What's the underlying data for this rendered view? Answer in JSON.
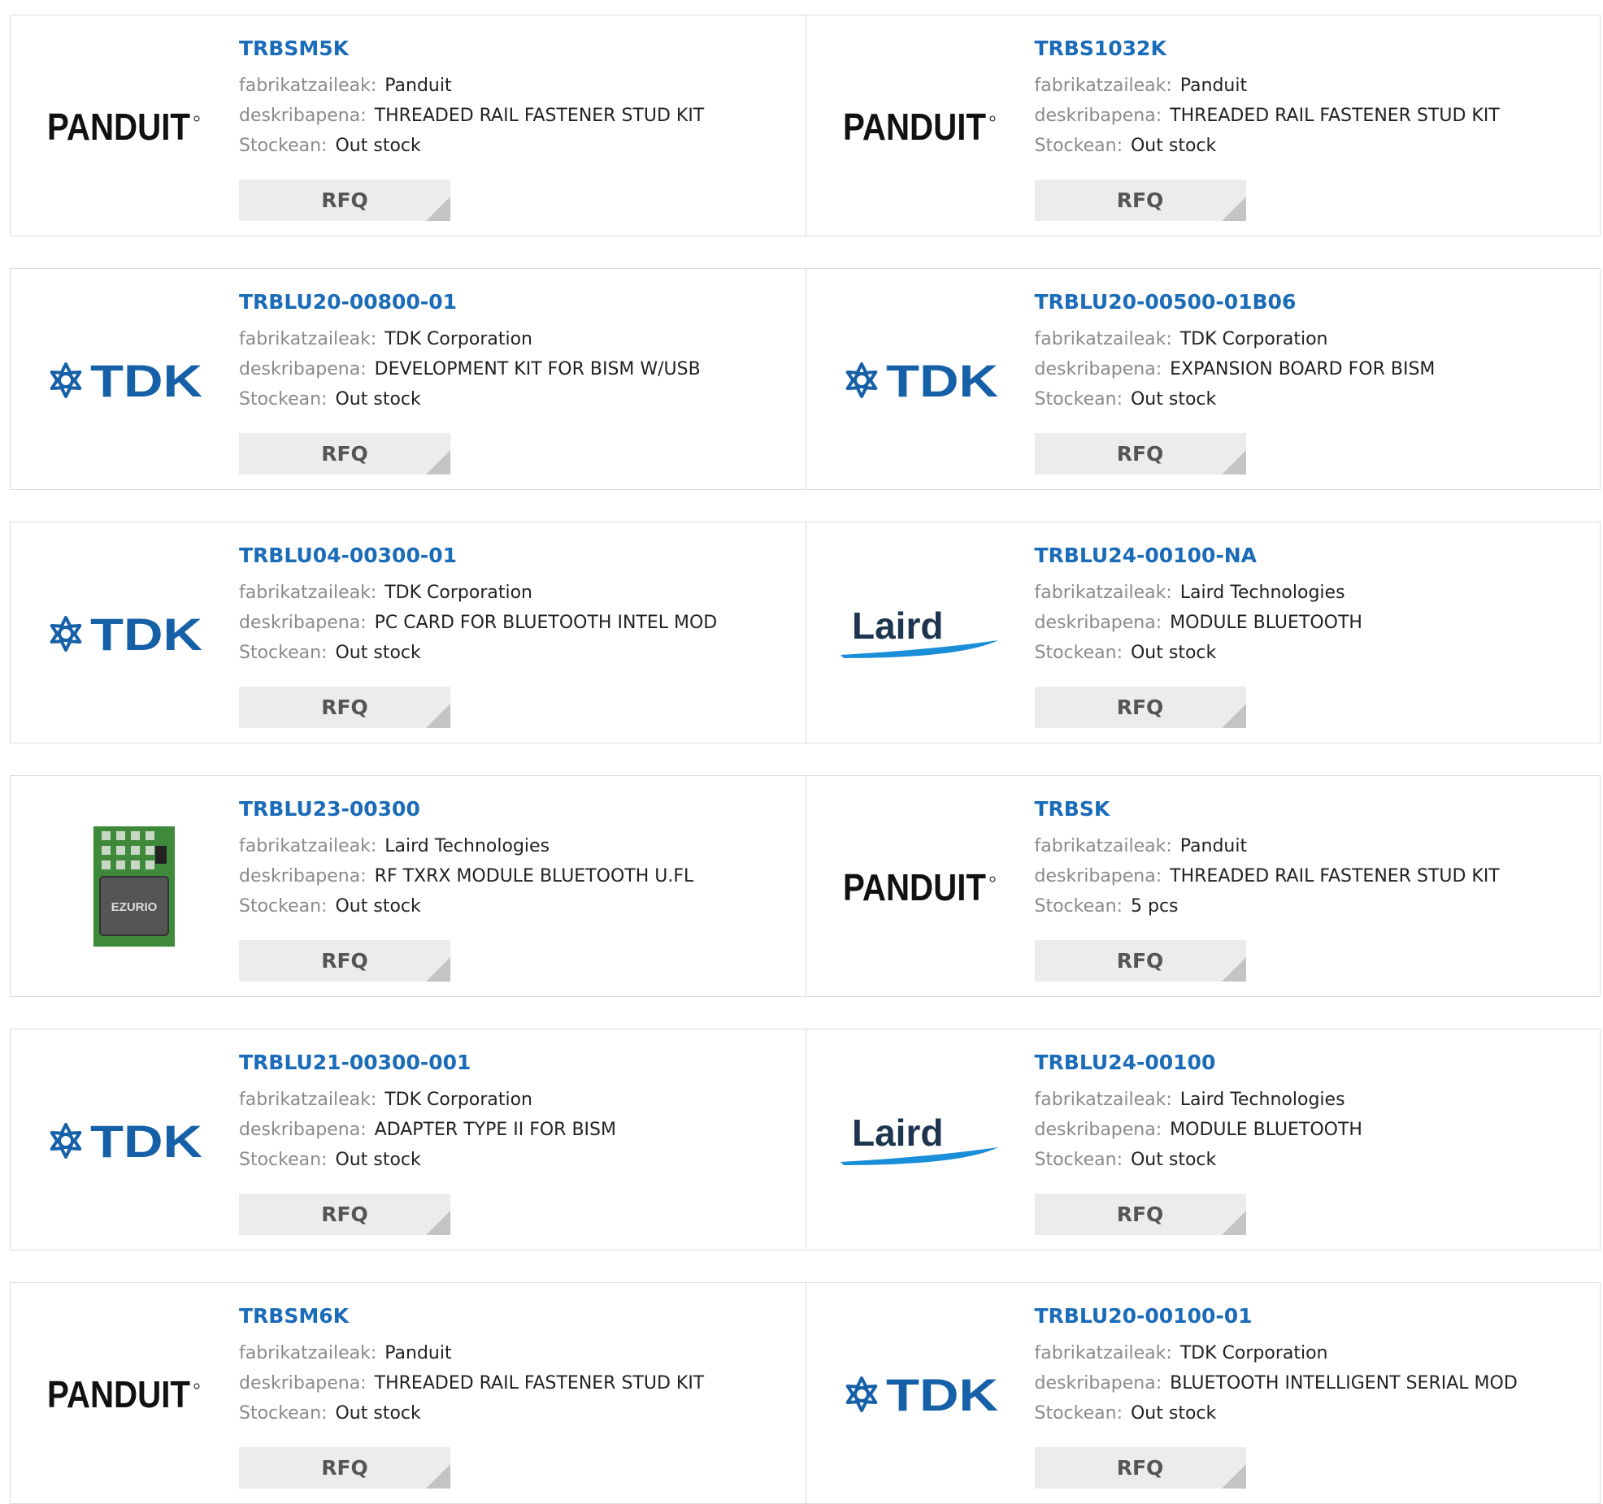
{
  "labels": {
    "manufacturer": "fabrikatzaileak:",
    "description": "deskribapena:",
    "stock": "Stockean:",
    "rfq": "RFQ"
  },
  "logos": {
    "panduit": {
      "text": "PANDUIT",
      "icon": "panduit-logo",
      "color": "#111111"
    },
    "tdk": {
      "text": "TDK",
      "icon": "tdk-logo",
      "color": "#1660a8"
    },
    "laird": {
      "text": "Laird",
      "icon": "laird-logo",
      "color": "#1e3550",
      "swoosh": "#1a8ed8"
    },
    "ezurio": {
      "text": "EZURIO",
      "icon": "ezurio-module-photo",
      "color": "#3e8a3a"
    }
  },
  "products": [
    {
      "part": "TRBSM5K",
      "manufacturer": "Panduit",
      "description": "THREADED RAIL FASTENER STUD KIT",
      "stock": "Out stock",
      "logo": "panduit"
    },
    {
      "part": "TRBS1032K",
      "manufacturer": "Panduit",
      "description": "THREADED RAIL FASTENER STUD KIT",
      "stock": "Out stock",
      "logo": "panduit"
    },
    {
      "part": "TRBLU20-00800-01",
      "manufacturer": "TDK Corporation",
      "description": "DEVELOPMENT KIT FOR BISM W/USB",
      "stock": "Out stock",
      "logo": "tdk"
    },
    {
      "part": "TRBLU20-00500-01B06",
      "manufacturer": "TDK Corporation",
      "description": "EXPANSION BOARD FOR BISM",
      "stock": "Out stock",
      "logo": "tdk"
    },
    {
      "part": "TRBLU04-00300-01",
      "manufacturer": "TDK Corporation",
      "description": "PC CARD FOR BLUETOOTH INTEL MOD",
      "stock": "Out stock",
      "logo": "tdk"
    },
    {
      "part": "TRBLU24-00100-NA",
      "manufacturer": "Laird Technologies",
      "description": "MODULE BLUETOOTH",
      "stock": "Out stock",
      "logo": "laird"
    },
    {
      "part": "TRBLU23-00300",
      "manufacturer": "Laird Technologies",
      "description": "RF TXRX MODULE BLUETOOTH U.FL",
      "stock": "Out stock",
      "logo": "ezurio"
    },
    {
      "part": "TRBSK",
      "manufacturer": "Panduit",
      "description": "THREADED RAIL FASTENER STUD KIT",
      "stock": "5 pcs",
      "logo": "panduit"
    },
    {
      "part": "TRBLU21-00300-001",
      "manufacturer": "TDK Corporation",
      "description": "ADAPTER TYPE II FOR BISM",
      "stock": "Out stock",
      "logo": "tdk"
    },
    {
      "part": "TRBLU24-00100",
      "manufacturer": "Laird Technologies",
      "description": "MODULE BLUETOOTH",
      "stock": "Out stock",
      "logo": "laird"
    },
    {
      "part": "TRBSM6K",
      "manufacturer": "Panduit",
      "description": "THREADED RAIL FASTENER STUD KIT",
      "stock": "Out stock",
      "logo": "panduit"
    },
    {
      "part": "TRBLU20-00100-01",
      "manufacturer": "TDK Corporation",
      "description": "BLUETOOTH INTELLIGENT SERIAL MOD",
      "stock": "Out stock",
      "logo": "tdk"
    }
  ]
}
